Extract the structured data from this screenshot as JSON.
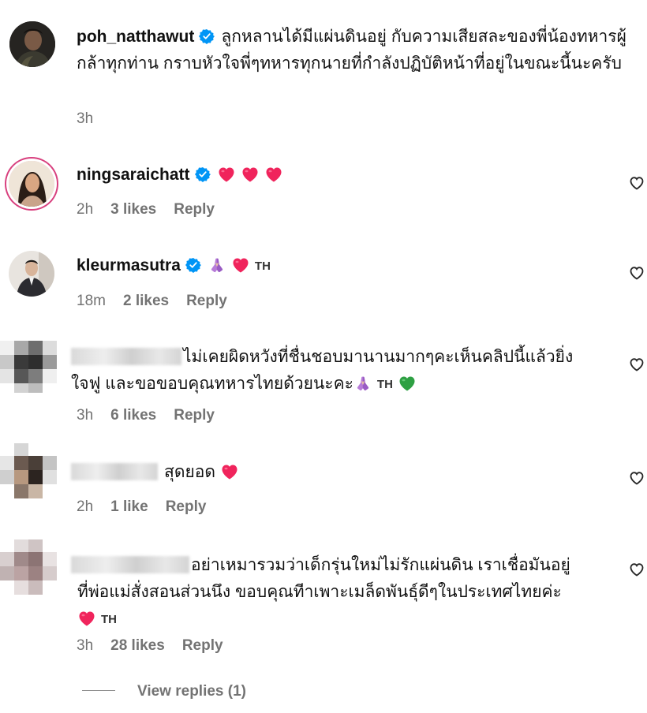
{
  "comments": [
    {
      "username": "poh_natthawut",
      "verified": true,
      "text": "ลูกหลานได้มีแผ่นดินอยู่ กับความเสียสละของพี่น้องทหารผู้กล้าทุกท่าน กราบหัวใจพี่ๆทหารทุกนายที่กำลังปฏิบัติหน้าที่อยู่ในขณะนี้นะครับ",
      "time": "3h"
    },
    {
      "username": "ningsaraichatt",
      "verified": true,
      "emoji": [
        "red-heart",
        "red-heart",
        "red-heart"
      ],
      "time": "2h",
      "likes": "3 likes",
      "reply": "Reply"
    },
    {
      "username": "kleurmasutra",
      "verified": true,
      "emoji": [
        "folded-hands",
        "red-heart"
      ],
      "tag": "TH",
      "time": "18m",
      "likes": "2 likes",
      "reply": "Reply"
    },
    {
      "username_blurred": true,
      "text_line1": "ไม่เคยผิดหวังที่ชื่นชอบมานานมากๆคะเห็นคลิปนี้แล้วยิ่ง",
      "text_line2": "ใจฟู และขอขอบคุณทหารไทยด้วยนะคะ",
      "emoji": [
        "folded-hands",
        "green-heart"
      ],
      "tag": "TH",
      "time": "3h",
      "likes": "6 likes",
      "reply": "Reply"
    },
    {
      "username_blurred": true,
      "text": "สุดยอด",
      "emoji": [
        "red-heart"
      ],
      "time": "2h",
      "likes": "1 like",
      "reply": "Reply"
    },
    {
      "username_blurred": true,
      "text_line1": "อย่าเหมารวมว่าเด็กรุ่นใหม่ไม่รักแผ่นดิน เราเชื่อมันอยู่",
      "text_line2": "ที่พ่อแม่สั่งสอนส่วนนึง ขอบคุณทีาเพาะเมล็ดพันธุ์ดีๆในประเทศไทยค่ะ",
      "emoji": [
        "red-heart"
      ],
      "tag": "TH",
      "time": "3h",
      "likes": "28 likes",
      "reply": "Reply"
    }
  ],
  "view_replies": "View replies (1)",
  "colors": {
    "meta_gray": "#737373",
    "verified_blue": "#0095f6",
    "heart_red": "#f0245c",
    "heart_green": "#2ea043"
  }
}
